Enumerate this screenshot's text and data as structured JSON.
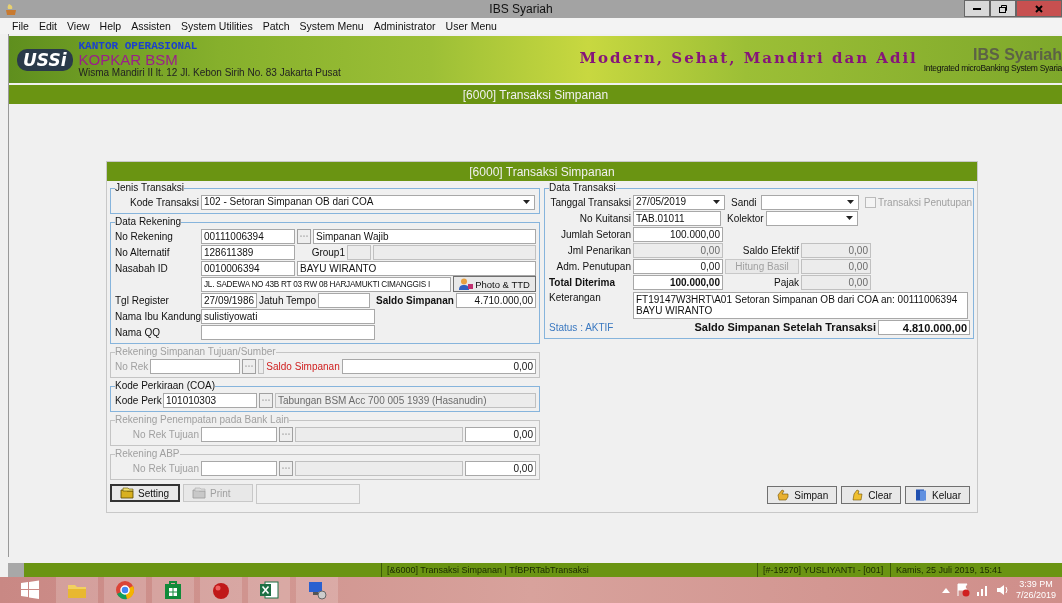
{
  "window": {
    "title": "IBS Syariah"
  },
  "menu": [
    "File",
    "Edit",
    "View",
    "Help",
    "Assisten",
    "System Utilities",
    "Patch",
    "System Menu",
    "Administrator",
    "User Menu"
  ],
  "banner": {
    "logo": "USSi",
    "office": "KANTOR OPERASIONAL",
    "company": "KOPKAR BSM",
    "address": "Wisma Mandiri II lt. 12 Jl. Kebon Sirih No. 83 Jakarta Pusat",
    "motto": "Modern, Sehat, Mandiri dan Adil",
    "product": "IBS Syariah",
    "product_subtitle": "Integrated microBanking System Syaria"
  },
  "page_title": "[6000] Transaksi Simpanan",
  "form": {
    "title": "[6000] Transaksi Simpanan",
    "jenis": {
      "legend": "Jenis Transaksi",
      "label": "Kode Transaksi",
      "value": "102 - Setoran Simpanan OB dari COA"
    },
    "rekening": {
      "legend": "Data Rekening",
      "no_rekening": {
        "label": "No Rekening",
        "value": "00111006394",
        "product": "Simpanan Wajib"
      },
      "no_alternatif": {
        "label": "No Alternatif",
        "value": "128611389",
        "group_label": "Group1"
      },
      "nasabah": {
        "label": "Nasabah ID",
        "value": "0010006394",
        "name": "BAYU WIRANTO"
      },
      "address": "JL. SADEWA NO 43B RT 03 RW 08 HARJAMUKTI CIMANGGIS I",
      "photo_button": "Photo & TTD",
      "tgl_register": {
        "label": "Tgl Register",
        "value": "27/09/1986"
      },
      "jatuh_tempo": {
        "label": "Jatuh Tempo"
      },
      "saldo": {
        "label": "Saldo Simpanan",
        "value": "4.710.000,00"
      },
      "ibu": {
        "label": "Nama Ibu Kandung",
        "value": "sulistiyowati"
      },
      "qq": {
        "label": "Nama QQ"
      }
    },
    "tujuan": {
      "legend": "Rekening Simpanan Tujuan/Sumber",
      "disabled": true,
      "label": "No Rek",
      "saldo_label": "Saldo Simpanan",
      "saldo": "0,00"
    },
    "coa": {
      "legend": "Kode Perkiraan (COA)",
      "disabled": false,
      "label": "Kode Perk",
      "value": "101010303",
      "name": "Tabungan BSM Acc 700 005 1939 (Hasanudin)"
    },
    "bank_lain": {
      "legend": "Rekening Penempatan pada Bank Lain",
      "disabled": true,
      "label": "No Rek Tujuan",
      "amount": "0,00"
    },
    "abp": {
      "legend": "Rekening ABP",
      "disabled": true,
      "label": "No Rek Tujuan",
      "amount": "0,00"
    },
    "left_buttons": [
      {
        "label": "Setting",
        "disabled": false
      },
      {
        "label": "Print",
        "disabled": true
      }
    ],
    "transaksi": {
      "legend": "Data Transaksi",
      "tanggal": {
        "label": "Tanggal Transaksi",
        "value": "27/05/2019"
      },
      "sandi": {
        "label": "Sandi"
      },
      "penutupan": {
        "label": "Transaksi Penutupan",
        "checked": false,
        "disabled": true
      },
      "no_kuitansi": {
        "label": "No Kuitansi",
        "value": "TAB.01011"
      },
      "kolektor": {
        "label": "Kolektor"
      },
      "jumlah_setoran": {
        "label": "Jumlah Setoran",
        "value": "100.000,00"
      },
      "jml_penarikan": {
        "label": "Jml Penarikan",
        "value": "0,00"
      },
      "saldo_efektif": {
        "label": "Saldo Efektif",
        "value": "0,00"
      },
      "adm": {
        "label": "Adm. Penutupan",
        "value": "0,00"
      },
      "hitung_basil": {
        "label": "Hitung Basil",
        "disabled": true,
        "value": "0,00"
      },
      "total": {
        "label": "Total Diterima",
        "value": "100.000,00"
      },
      "pajak": {
        "label": "Pajak",
        "value": "0,00"
      },
      "keterangan": {
        "label": "Keterangan",
        "value": "FT19147W3HRT\\A01 Setoran Simpanan OB dari COA an: 00111006394 BAYU WIRANTO"
      },
      "status": "Status : AKTIF",
      "saldo_setelah": {
        "label": "Saldo Simpanan Setelah Transaksi",
        "value": "4.810.000,00"
      }
    },
    "right_buttons": [
      {
        "label": "Simpan",
        "kind": "save",
        "disabled": false
      },
      {
        "label": "Clear",
        "kind": "clear",
        "disabled": false
      },
      {
        "label": "Keluar",
        "kind": "exit",
        "disabled": false
      }
    ]
  },
  "status_bar": [
    "[&6000] Transaksi Simpanan  | TfBPRTabTransaksi",
    "[#-19270] YUSLIYANTI - [001]",
    "Kamis, 25 Juli 2019, 15:41"
  ],
  "taskbar": {
    "time": "3:39 PM",
    "date": "7/26/2019"
  }
}
